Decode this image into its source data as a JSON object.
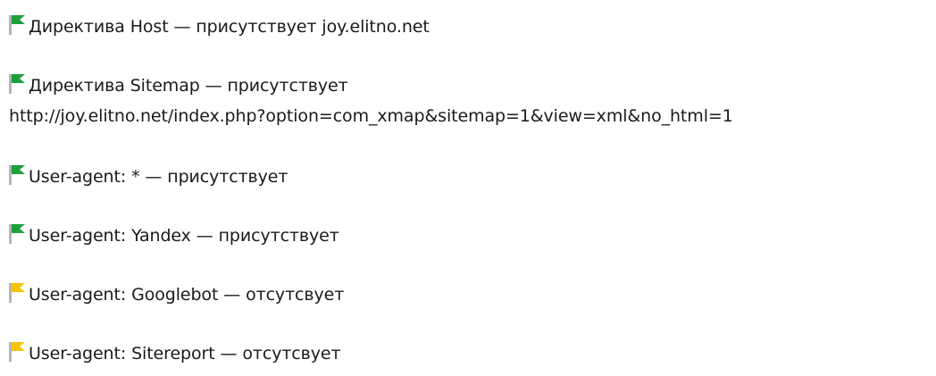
{
  "colors": {
    "present_flag": "#1e9e3c",
    "absent_flag": "#f5c400",
    "pole": "#b5b5b5",
    "text": "#1a1a1a"
  },
  "items": [
    {
      "status": "present",
      "icon": "green-flag-icon",
      "text": "Директива Host — присутствует joy.elitno.net"
    },
    {
      "status": "present",
      "icon": "green-flag-icon",
      "text": "Директива Sitemap — присутствует",
      "text_line2": "http://joy.elitno.net/index.php?option=com_xmap&sitemap=1&view=xml&no_html=1"
    },
    {
      "status": "present",
      "icon": "green-flag-icon",
      "text": "User-agent: * — присутствует"
    },
    {
      "status": "present",
      "icon": "green-flag-icon",
      "text": "User-agent: Yandex — присутствует"
    },
    {
      "status": "absent",
      "icon": "yellow-flag-icon",
      "text": "User-agent: Googlebot — отсутсвует"
    },
    {
      "status": "absent",
      "icon": "yellow-flag-icon",
      "text": "User-agent: Sitereport — отсутсвует"
    }
  ]
}
